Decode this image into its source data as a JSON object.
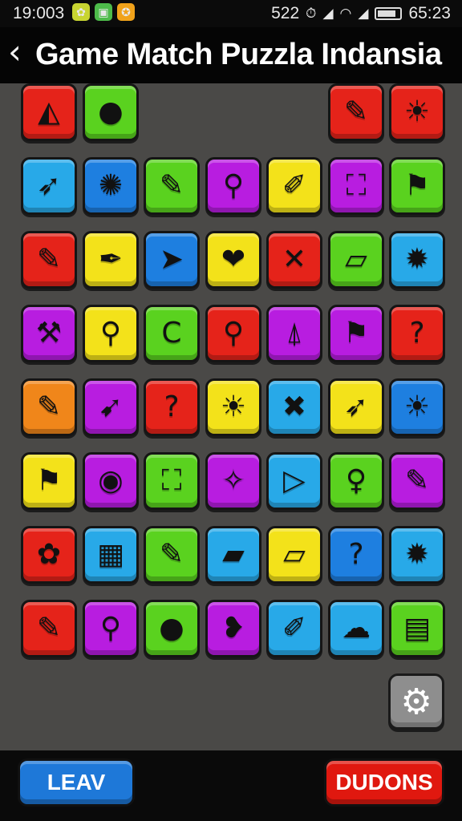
{
  "status_bar": {
    "time": "19:003",
    "center_number": "522",
    "clock": "65:23",
    "left_icons": [
      {
        "name": "flower-icon",
        "glyph": "✿",
        "color": "#c8d431"
      },
      {
        "name": "jar-icon",
        "glyph": "▣",
        "color": "#4dbb4a"
      },
      {
        "name": "coin-icon",
        "glyph": "✪",
        "color": "#f0a21a"
      }
    ]
  },
  "header": {
    "back_glyph": "‹",
    "title": "Game Match Puzzla Indansia"
  },
  "board": {
    "tiles": [
      [
        {
          "icon": "pizza-icon",
          "glyph": "◭",
          "color": "#e5231a"
        },
        {
          "icon": "balloon-icon",
          "glyph": "●",
          "color": "#5ad21f"
        },
        null,
        null,
        null,
        {
          "icon": "pencil-icon",
          "glyph": "✎",
          "color": "#e5231a"
        },
        {
          "icon": "sun-icon",
          "glyph": "☀",
          "color": "#e5231a"
        }
      ],
      [
        {
          "icon": "arrow-icon",
          "glyph": "➶",
          "color": "#28a9e8"
        },
        {
          "icon": "germ-icon",
          "glyph": "✺",
          "color": "#1e7fe0"
        },
        {
          "icon": "crayon-icon",
          "glyph": "✎",
          "color": "#5ad21f"
        },
        {
          "icon": "magnifier-icon",
          "glyph": "⚲",
          "color": "#b81de0"
        },
        {
          "icon": "brush-icon",
          "glyph": "✐",
          "color": "#f3e21a"
        },
        {
          "icon": "cart-icon",
          "glyph": "⛶",
          "color": "#b81de0"
        },
        {
          "icon": "flag-icon",
          "glyph": "⚑",
          "color": "#5ad21f"
        }
      ],
      [
        {
          "icon": "crayon-icon",
          "glyph": "✎",
          "color": "#e5231a"
        },
        {
          "icon": "feather-icon",
          "glyph": "✒",
          "color": "#f3e21a"
        },
        {
          "icon": "paper-plane-icon",
          "glyph": "➤",
          "color": "#1e7fe0"
        },
        {
          "icon": "apple-icon",
          "glyph": "❤",
          "color": "#f3e21a"
        },
        {
          "icon": "compass-icon",
          "glyph": "✕",
          "color": "#e5231a"
        },
        {
          "icon": "note-icon",
          "glyph": "▱",
          "color": "#5ad21f"
        },
        {
          "icon": "gem-icon",
          "glyph": "✹",
          "color": "#28a9e8"
        }
      ],
      [
        {
          "icon": "broom-icon",
          "glyph": "⚒",
          "color": "#b81de0"
        },
        {
          "icon": "magnifier-icon",
          "glyph": "⚲",
          "color": "#f3e21a"
        },
        {
          "icon": "letter-c-icon",
          "glyph": "C",
          "color": "#5ad21f"
        },
        {
          "icon": "spoon-icon",
          "glyph": "⚲",
          "color": "#e5231a"
        },
        {
          "icon": "easel-icon",
          "glyph": "⍋",
          "color": "#b81de0"
        },
        {
          "icon": "flag-icon",
          "glyph": "⚑",
          "color": "#b81de0"
        },
        {
          "icon": "question-icon",
          "glyph": "?",
          "color": "#e5231a"
        }
      ],
      [
        {
          "icon": "pencil-icon",
          "glyph": "✎",
          "color": "#f0861a"
        },
        {
          "icon": "bow-icon",
          "glyph": "➹",
          "color": "#b81de0"
        },
        {
          "icon": "question-icon",
          "glyph": "?",
          "color": "#e5231a"
        },
        {
          "icon": "sun-icon",
          "glyph": "☀",
          "color": "#f3e21a"
        },
        {
          "icon": "bone-icon",
          "glyph": "✖",
          "color": "#28a9e8"
        },
        {
          "icon": "rocket-icon",
          "glyph": "➶",
          "color": "#f3e21a"
        },
        {
          "icon": "sun-icon",
          "glyph": "☀",
          "color": "#1e7fe0"
        }
      ],
      [
        {
          "icon": "flag-icon",
          "glyph": "⚑",
          "color": "#f3e21a"
        },
        {
          "icon": "pie-icon",
          "glyph": "◉",
          "color": "#b81de0"
        },
        {
          "icon": "cart-icon",
          "glyph": "⛶",
          "color": "#5ad21f"
        },
        {
          "icon": "wand-icon",
          "glyph": "✧",
          "color": "#b81de0"
        },
        {
          "icon": "pennant-icon",
          "glyph": "▷",
          "color": "#28a9e8"
        },
        {
          "icon": "bulb-icon",
          "glyph": "♀",
          "color": "#5ad21f"
        },
        {
          "icon": "crayon-icon",
          "glyph": "✎",
          "color": "#b81de0"
        }
      ],
      [
        {
          "icon": "flower-icon",
          "glyph": "✿",
          "color": "#e5231a"
        },
        {
          "icon": "palette-grid-icon",
          "glyph": "▦",
          "color": "#28a9e8"
        },
        {
          "icon": "pencil-icon",
          "glyph": "✎",
          "color": "#5ad21f"
        },
        {
          "icon": "eraser-icon",
          "glyph": "▰",
          "color": "#28a9e8"
        },
        {
          "icon": "note-icon",
          "glyph": "▱",
          "color": "#f3e21a"
        },
        {
          "icon": "question-icon",
          "glyph": "?",
          "color": "#1e7fe0"
        },
        {
          "icon": "gem-icon",
          "glyph": "✹",
          "color": "#28a9e8"
        }
      ],
      [
        {
          "icon": "pencil-icon",
          "glyph": "✎",
          "color": "#e5231a"
        },
        {
          "icon": "magnifier-icon",
          "glyph": "⚲",
          "color": "#b81de0"
        },
        {
          "icon": "balloon-icon",
          "glyph": "●",
          "color": "#5ad21f"
        },
        {
          "icon": "heart-wand-icon",
          "glyph": "❥",
          "color": "#b81de0"
        },
        {
          "icon": "brush-icon",
          "glyph": "✐",
          "color": "#28a9e8"
        },
        {
          "icon": "cloud-icon",
          "glyph": "☁",
          "color": "#28a9e8"
        },
        {
          "icon": "color-chart-icon",
          "glyph": "▤",
          "color": "#5ad21f"
        }
      ]
    ]
  },
  "settings_button": {
    "icon": "gear-icon",
    "glyph": "⚙"
  },
  "footer": {
    "leave_label": "LEAV",
    "dudons_label": "DUDONS"
  }
}
